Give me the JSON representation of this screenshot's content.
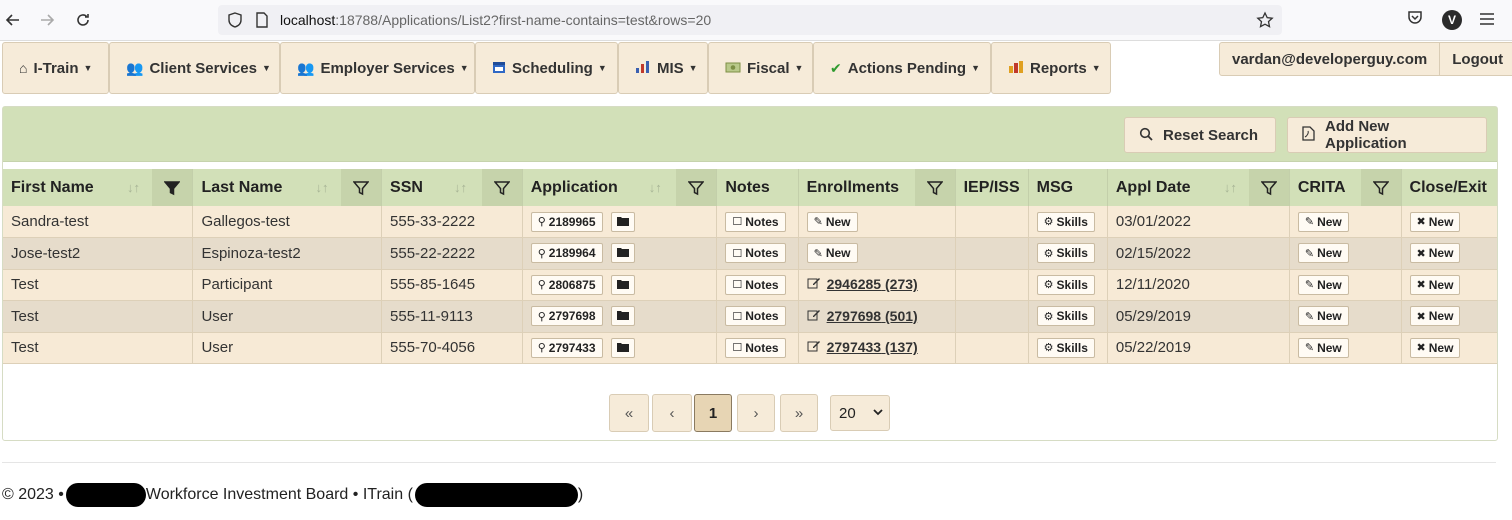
{
  "browser": {
    "url_host": "localhost",
    "url_rest": ":18788/Applications/List2?first-name-contains=test&rows=20",
    "profile_initial": "V"
  },
  "nav": {
    "items": [
      {
        "label": "I-Train",
        "icon": "home-icon"
      },
      {
        "label": "Client Services",
        "icon": "users-icon"
      },
      {
        "label": "Employer Services",
        "icon": "users-icon"
      },
      {
        "label": "Scheduling",
        "icon": "calendar-icon"
      },
      {
        "label": "MIS",
        "icon": "chart-icon"
      },
      {
        "label": "Fiscal",
        "icon": "money-icon"
      },
      {
        "label": "Actions Pending",
        "icon": "check-icon"
      },
      {
        "label": "Reports",
        "icon": "report-icon"
      }
    ],
    "user_email": "vardan@developerguy.com",
    "logout": "Logout"
  },
  "toolbar": {
    "reset_search": "Reset Search",
    "add_new_application": "Add New Application"
  },
  "table": {
    "headers": {
      "first_name": "First Name",
      "last_name": "Last Name",
      "ssn": "SSN",
      "application": "Application",
      "notes": "Notes",
      "enrollments": "Enrollments",
      "iep_iss": "IEP/ISS",
      "msg": "MSG",
      "appl_date": "Appl Date",
      "crita": "CRITA",
      "close_exit": "Close/Exit"
    },
    "notes_label": "Notes",
    "new_label": "New",
    "skills_label": "Skills",
    "rows": [
      {
        "first": "Sandra-test",
        "last": "Gallegos-test",
        "ssn": "555-33-2222",
        "app": "2189965",
        "enr_id": "",
        "enr_count": "",
        "date": "03/01/2022"
      },
      {
        "first": "Jose-test2",
        "last": "Espinoza-test2",
        "ssn": "555-22-2222",
        "app": "2189964",
        "enr_id": "",
        "enr_count": "",
        "date": "02/15/2022"
      },
      {
        "first": "Test",
        "last": "Participant",
        "ssn": "555-85-1645",
        "app": "2806875",
        "enr_id": "2946285",
        "enr_count": "(273)",
        "date": "12/11/2020"
      },
      {
        "first": "Test",
        "last": "User",
        "ssn": "555-11-9113",
        "app": "2797698",
        "enr_id": "2797698",
        "enr_count": "(501)",
        "date": "05/29/2019"
      },
      {
        "first": "Test",
        "last": "User",
        "ssn": "555-70-4056",
        "app": "2797433",
        "enr_id": "2797433",
        "enr_count": "(137)",
        "date": "05/22/2019"
      }
    ]
  },
  "pagination": {
    "first": "«",
    "prev": "‹",
    "current": "1",
    "next": "›",
    "last": "»",
    "rows_per_page": "20"
  },
  "footer": {
    "copyright": "© 2023 •",
    "org": "Workforce Investment Board • ITrain (",
    "close": ")"
  }
}
